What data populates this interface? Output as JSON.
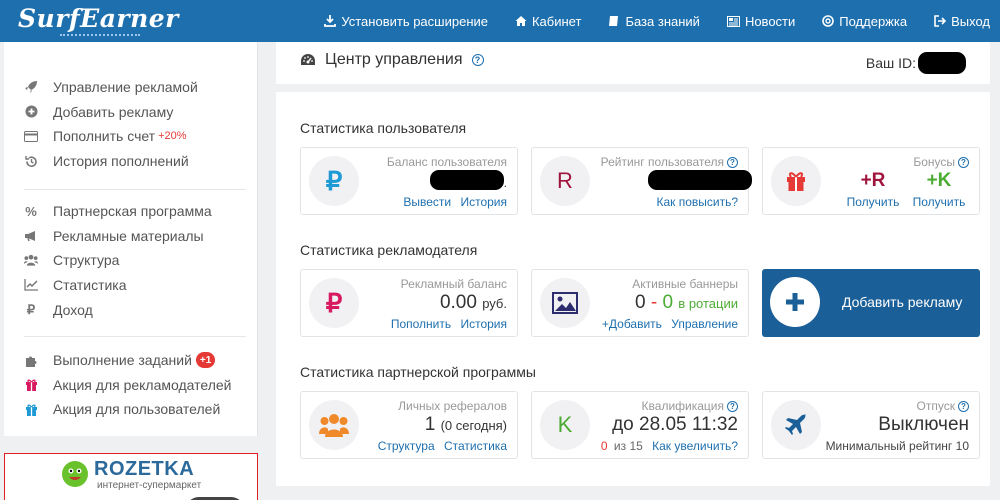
{
  "app": {
    "logo": "SurfEarner"
  },
  "topnav": [
    {
      "label": "Установить расширение",
      "icon": "download-icon"
    },
    {
      "label": "Кабинет",
      "icon": "home-icon"
    },
    {
      "label": "База знаний",
      "icon": "book-icon"
    },
    {
      "label": "Новости",
      "icon": "news-icon"
    },
    {
      "label": "Поддержка",
      "icon": "lifebuoy-icon"
    },
    {
      "label": "Выход",
      "icon": "logout-icon"
    }
  ],
  "sidebar": {
    "group1": [
      {
        "label": "Управление рекламой",
        "icon": "rocket-icon"
      },
      {
        "label": "Добавить рекламу",
        "icon": "plus-circle-icon"
      },
      {
        "label": "Пополнить счет",
        "icon": "credit-card-icon",
        "extra": "+20%"
      },
      {
        "label": "История пополнений",
        "icon": "history-icon"
      }
    ],
    "group2": [
      {
        "label": "Партнерская программа",
        "icon": "percent-icon"
      },
      {
        "label": "Рекламные материалы",
        "icon": "megaphone-icon"
      },
      {
        "label": "Структура",
        "icon": "users-icon"
      },
      {
        "label": "Статистика",
        "icon": "chart-icon"
      },
      {
        "label": "Доход",
        "icon": "ruble-icon"
      }
    ],
    "group3": [
      {
        "label": "Выполнение заданий",
        "icon": "puzzle-icon",
        "badge": "+1"
      },
      {
        "label": "Акция для рекламодателей",
        "icon": "gift-red-icon"
      },
      {
        "label": "Акция для пользователей",
        "icon": "gift-blue-icon"
      }
    ]
  },
  "ad": {
    "brand": "ROZETKA",
    "tagline": "интернет-супермаркет"
  },
  "main": {
    "title": "Центр управления",
    "id_label": "Ваш ID:",
    "sections": {
      "user": "Статистика пользователя",
      "advertiser": "Статистика рекламодателя",
      "partner": "Статистика партнерской программы"
    },
    "user_cards": {
      "balance": {
        "label": "Баланс пользователя",
        "value_suffix": ".",
        "links": [
          "Вывести",
          "История"
        ]
      },
      "rating": {
        "label": "Рейтинг пользователя",
        "icon_letter": "R",
        "link": "Как повысить?"
      },
      "bonus": {
        "label": "Бонусы",
        "items": [
          {
            "value": "+R",
            "link": "Получить"
          },
          {
            "value": "+K",
            "link": "Получить"
          }
        ]
      }
    },
    "advertiser_cards": {
      "ad_balance": {
        "label": "Рекламный баланс",
        "value": "0.00",
        "unit": "руб.",
        "links": [
          "Пополнить",
          "История"
        ]
      },
      "banners": {
        "label": "Активные баннеры",
        "active": "0",
        "dash": "-",
        "rotation": "0",
        "rotation_label": "в ротации",
        "links": [
          "+Добавить",
          "Управление"
        ]
      },
      "cta": {
        "label": "Добавить рекламу"
      }
    },
    "partner_cards": {
      "referrals": {
        "label": "Личных рефералов",
        "value": "1",
        "today": "(0 сегодня)",
        "links": [
          "Структура",
          "Статистика"
        ]
      },
      "qualification": {
        "label": "Квалификация",
        "icon_letter": "K",
        "value": "до 28.05 11:32",
        "progress_current": "0",
        "progress_text": "из 15",
        "link": "Как увеличить?"
      },
      "vacation": {
        "label": "Отпуск",
        "value": "Выключен",
        "sub": "Минимальный рейтинг 10"
      }
    }
  },
  "colors": {
    "primary": "#1e6fae",
    "cta": "#1a5f98",
    "accent_red": "#e53935",
    "accent_green": "#4cab33",
    "rating_red": "#a0153e"
  }
}
